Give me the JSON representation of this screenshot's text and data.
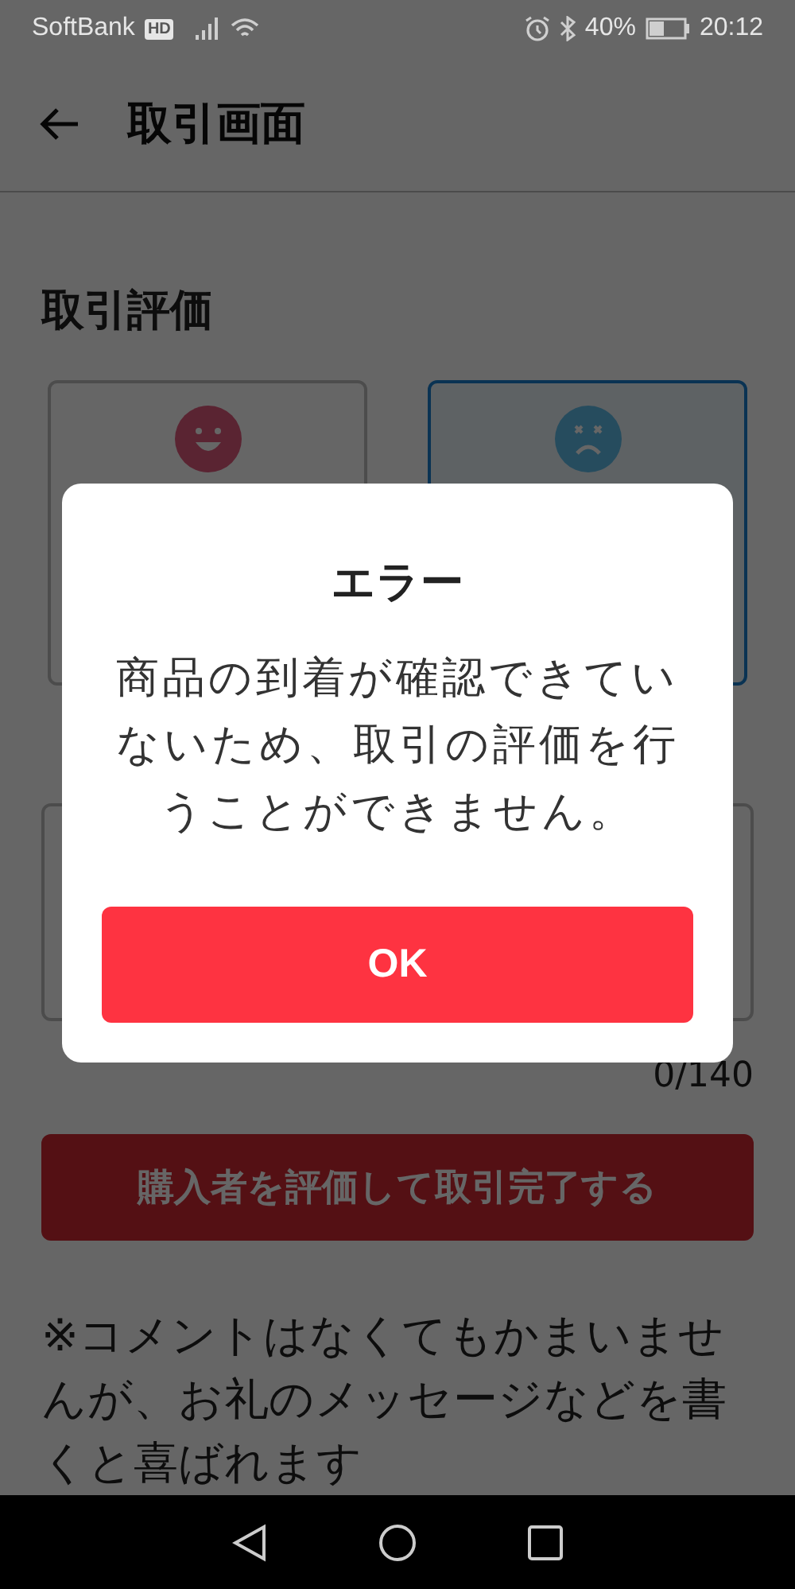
{
  "status_bar": {
    "carrier": "SoftBank",
    "carrier_badge": "HD",
    "battery_percent": "40%",
    "time": "20:12"
  },
  "header": {
    "title": "取引画面"
  },
  "section_title": "取引評価",
  "rating_options": [
    {
      "kind": "good",
      "selected": false
    },
    {
      "kind": "bad",
      "selected": true
    }
  ],
  "comment": {
    "counter": "0/140"
  },
  "submit_button": {
    "label": "購入者を評価して取引完了する",
    "disabled": true
  },
  "note": "※コメントはなくてもかまいませんが、お礼のメッセージなどを書くと喜ばれます",
  "dialog": {
    "title": "エラー",
    "message": "商品の到着が確認できていないため、取引の評価を行うことができません。",
    "button": "OK"
  }
}
